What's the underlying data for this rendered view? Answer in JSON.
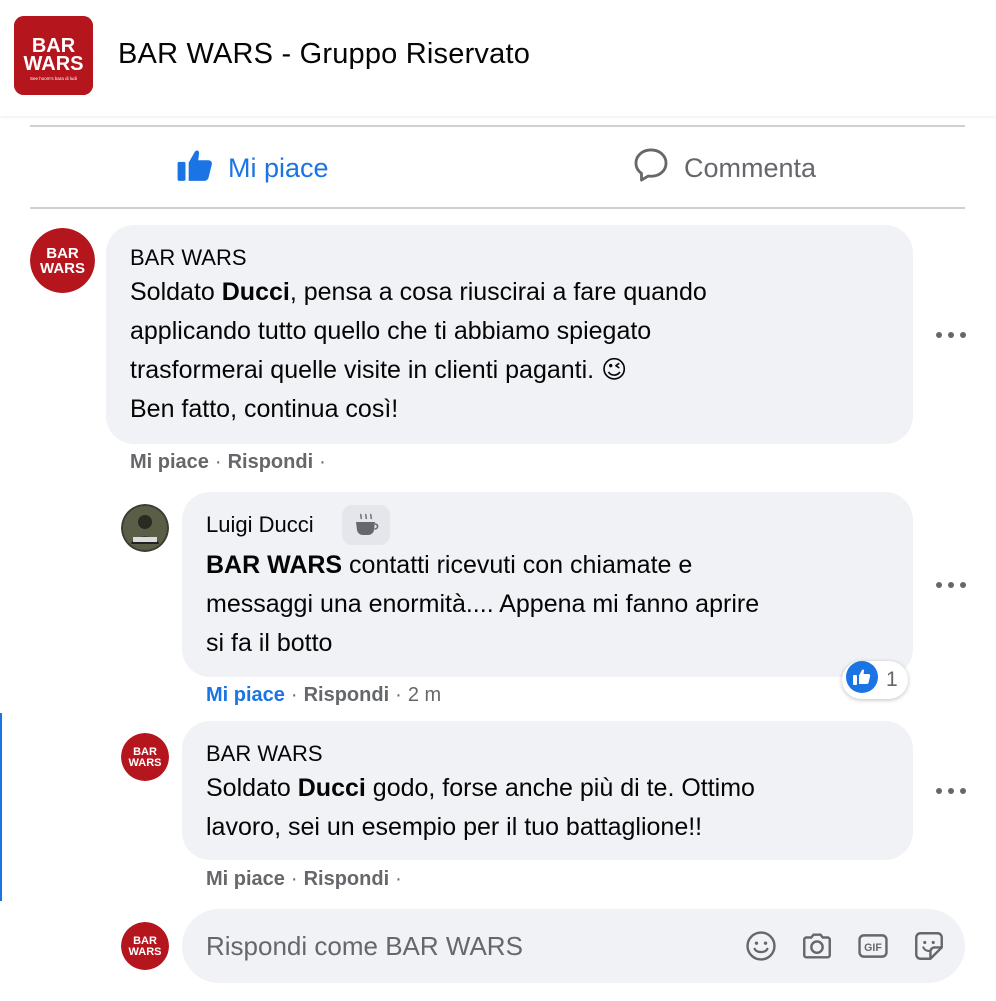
{
  "header": {
    "group_name": "BAR WARS - Gruppo Riservato",
    "logo_text_line1": "BAR",
    "logo_text_line2": "WARS",
    "logo_tagline": "See hoom's bara di ludi"
  },
  "post_actions": {
    "like_label": "Mi piace",
    "comment_label": "Commenta"
  },
  "comments": [
    {
      "author": "BAR WARS",
      "text_prefix": "Soldato ",
      "mention": "Ducci",
      "text_line1_rest": ", pensa a cosa riuscirai a fare quando",
      "text_line2": "applicando tutto quello che ti abbiamo spiegato",
      "text_line3": "trasformerai quelle visite in clienti paganti. ",
      "emoji": "😉",
      "text_line4": "Ben fatto, continua così!",
      "like_label": "Mi piace",
      "reply_label": "Rispondi",
      "separator": "·"
    },
    {
      "author": "Luigi Ducci",
      "badge_icon": "coffee-cup",
      "mention": "BAR WARS",
      "text_line1_rest": " contatti ricevuti con chiamate e",
      "text_line2": "messaggi una enormità.... Appena mi fanno aprire",
      "text_line3": "si fa il botto",
      "like_label": "Mi piace",
      "reply_label": "Rispondi",
      "separator": "·",
      "time": "2 m",
      "reaction_count": "1",
      "liked": true
    },
    {
      "author": "BAR WARS",
      "text_prefix": "Soldato ",
      "mention": "Ducci",
      "text_line1_rest": " godo, forse anche più di te. Ottimo",
      "text_line2": "lavoro, sei un esempio per il tuo battaglione!!",
      "like_label": "Mi piace",
      "reply_label": "Rispondi",
      "separator": "·"
    }
  ],
  "reply": {
    "placeholder": "Rispondi come BAR WARS",
    "tools": [
      "emoji-icon",
      "camera-icon",
      "gif-icon",
      "sticker-icon"
    ]
  },
  "colors": {
    "accent": "#1b74e4",
    "brand_red": "#b5161e",
    "bubble": "#f0f2f5",
    "secondary_text": "#65676b"
  }
}
